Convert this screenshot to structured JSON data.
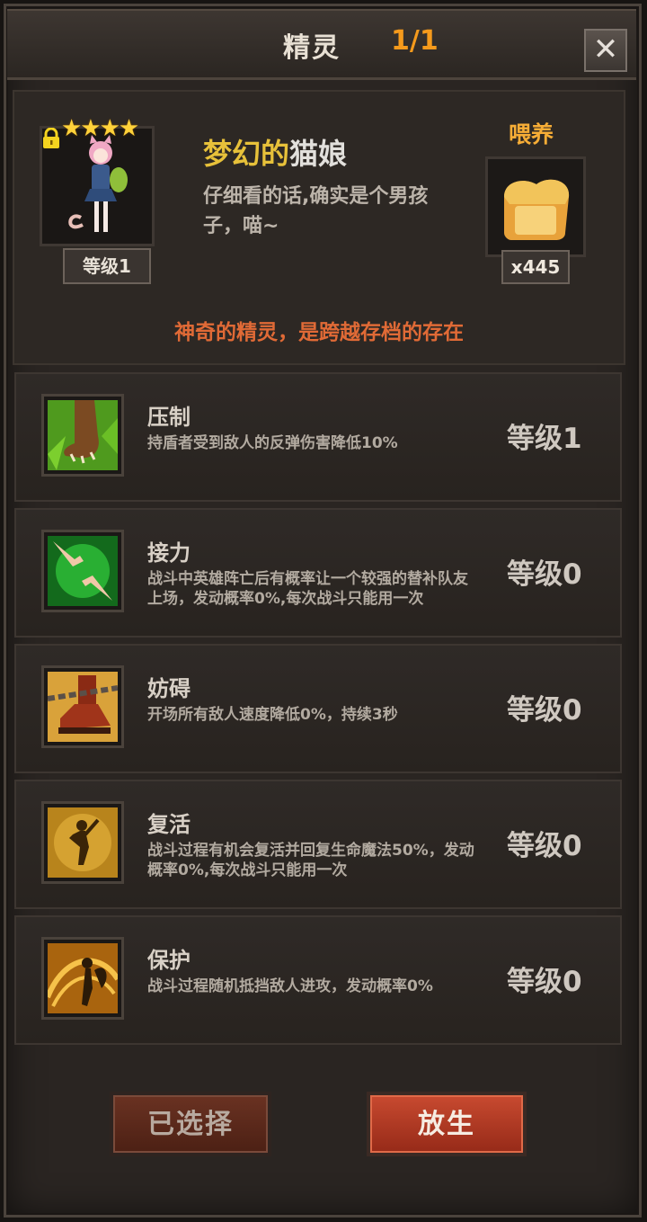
{
  "header": {
    "title": "精灵",
    "count": "1/1",
    "close_label": "✕"
  },
  "spirit": {
    "stars": "★★★★",
    "level_label": "等级1",
    "name_part1": "梦幻的",
    "name_part2": "猫娘",
    "description": "仔细看的话,确实是个男孩子，喵~",
    "feed_label": "喂养",
    "food_count": "x445",
    "tagline": "神奇的精灵，是跨越存档的存在"
  },
  "skills": [
    {
      "name": "压制",
      "desc": "持盾者受到敌人的反弹伤害降低10%",
      "level": "等级1",
      "icon": "claw-icon"
    },
    {
      "name": "接力",
      "desc": "战斗中英雄阵亡后有概率让一个较强的替补队友上场，发动概率0%,每次战斗只能用一次",
      "level": "等级0",
      "icon": "hands-icon"
    },
    {
      "name": "妨碍",
      "desc": "开场所有敌人速度降低0%，持续3秒",
      "level": "等级0",
      "icon": "chained-boot-icon"
    },
    {
      "name": "复活",
      "desc": "战斗过程有机会复活并回复生命魔法50%，发动概率0%,每次战斗只能用一次",
      "level": "等级0",
      "icon": "revive-icon"
    },
    {
      "name": "保护",
      "desc": "战斗过程随机抵挡敌人进攻，发动概率0%",
      "level": "等级0",
      "icon": "protect-icon"
    }
  ],
  "buttons": {
    "selected_label": "已选择",
    "release_label": "放生"
  },
  "colors": {
    "accent": "#f59a1c",
    "tagline": "#e06a36",
    "name_highlight": "#e7c13a"
  }
}
